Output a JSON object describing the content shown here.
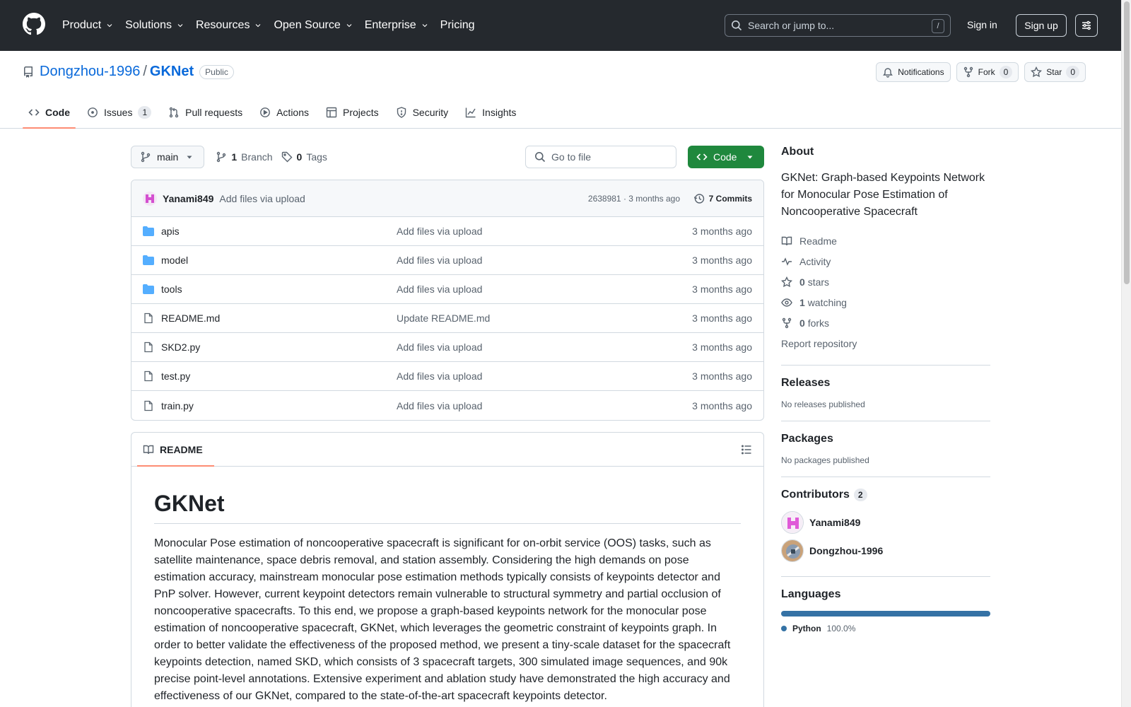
{
  "header": {
    "nav": [
      {
        "label": "Product",
        "has_menu": true
      },
      {
        "label": "Solutions",
        "has_menu": true
      },
      {
        "label": "Resources",
        "has_menu": true
      },
      {
        "label": "Open Source",
        "has_menu": true
      },
      {
        "label": "Enterprise",
        "has_menu": true
      },
      {
        "label": "Pricing",
        "has_menu": false
      }
    ],
    "search_placeholder": "Search or jump to...",
    "search_shortcut": "/",
    "signin": "Sign in",
    "signup": "Sign up"
  },
  "repo": {
    "owner": "Dongzhou-1996",
    "separator": "/",
    "name": "GKNet",
    "visibility": "Public",
    "notifications_label": "Notifications",
    "fork_label": "Fork",
    "fork_count": "0",
    "star_label": "Star",
    "star_count": "0",
    "tabs": [
      {
        "label": "Code",
        "icon": "code-icon",
        "active": true,
        "count": ""
      },
      {
        "label": "Issues",
        "icon": "issue-icon",
        "active": false,
        "count": "1"
      },
      {
        "label": "Pull requests",
        "icon": "pull-request-icon",
        "active": false,
        "count": ""
      },
      {
        "label": "Actions",
        "icon": "play-icon",
        "active": false,
        "count": ""
      },
      {
        "label": "Projects",
        "icon": "table-icon",
        "active": false,
        "count": ""
      },
      {
        "label": "Security",
        "icon": "shield-icon",
        "active": false,
        "count": ""
      },
      {
        "label": "Insights",
        "icon": "graph-icon",
        "active": false,
        "count": ""
      }
    ]
  },
  "toolbar": {
    "branch": "main",
    "branch_count": "1",
    "branch_label": "Branch",
    "tag_count": "0",
    "tag_label": "Tags",
    "goto_placeholder": "Go to file",
    "code_label": "Code"
  },
  "latest_commit": {
    "author": "Yanami849",
    "message": "Add files via upload",
    "meta": "2638981 · 3 months ago",
    "commits_label": "7 Commits"
  },
  "files": [
    {
      "name": "apis",
      "type": "dir",
      "message": "Add files via upload",
      "time": "3 months ago"
    },
    {
      "name": "model",
      "type": "dir",
      "message": "Add files via upload",
      "time": "3 months ago"
    },
    {
      "name": "tools",
      "type": "dir",
      "message": "Add files via upload",
      "time": "3 months ago"
    },
    {
      "name": "README.md",
      "type": "file",
      "message": "Update README.md",
      "time": "3 months ago"
    },
    {
      "name": "SKD2.py",
      "type": "file",
      "message": "Add files via upload",
      "time": "3 months ago"
    },
    {
      "name": "test.py",
      "type": "file",
      "message": "Add files via upload",
      "time": "3 months ago"
    },
    {
      "name": "train.py",
      "type": "file",
      "message": "Add files via upload",
      "time": "3 months ago"
    }
  ],
  "readme": {
    "tab_label": "README",
    "title": "GKNet",
    "body": "Monocular Pose estimation of noncooperative spacecraft is significant for on-orbit service (OOS) tasks, such as satellite maintenance, space debris removal, and station assembly. Considering the high demands on pose estimation accuracy, mainstream monocular pose estimation methods typically consists of keypoints detector and PnP solver. However, current keypoint detectors remain vulnerable to structural symmetry and partial occlusion of noncooperative spacecrafts. To this end, we propose a graph-based keypoints network for the monocular pose estimation of noncooperative spacecraft, GKNet, which leverages the geometric constraint of keypoints graph. In order to better validate the effectiveness of the proposed method, we present a tiny-scale dataset for the spacecraft keypoints detection, named SKD, which consists of 3 spacecraft targets, 300 simulated image sequences, and 90k precise point-level annotations. Extensive experiment and ablation study have demonstrated the high accuracy and effectiveness of our GKNet, compared to the state-of-the-art spacecraft keypoints detector."
  },
  "sidebar": {
    "about_title": "About",
    "description": "GKNet: Graph-based Keypoints Network for Monocular Pose Estimation of Noncooperative Spacecraft",
    "readme_link": "Readme",
    "activity_link": "Activity",
    "stars_count": "0",
    "stars_label": "stars",
    "watching_count": "1",
    "watching_label": "watching",
    "forks_count": "0",
    "forks_label": "forks",
    "report_link": "Report repository",
    "releases_title": "Releases",
    "releases_empty": "No releases published",
    "packages_title": "Packages",
    "packages_empty": "No packages published",
    "contributors_title": "Contributors",
    "contributors_count": "2",
    "contributors": [
      {
        "name": "Yanami849"
      },
      {
        "name": "Dongzhou-1996"
      }
    ],
    "languages_title": "Languages",
    "languages": [
      {
        "name": "Python",
        "percent": "100.0%",
        "color": "#3572A5"
      }
    ]
  },
  "colors": {
    "header_bg": "#25292e",
    "link": "#0969da",
    "primary_button": "#1f883d",
    "active_tab_underline": "#fd8c73",
    "folder_icon": "#54aeff"
  }
}
